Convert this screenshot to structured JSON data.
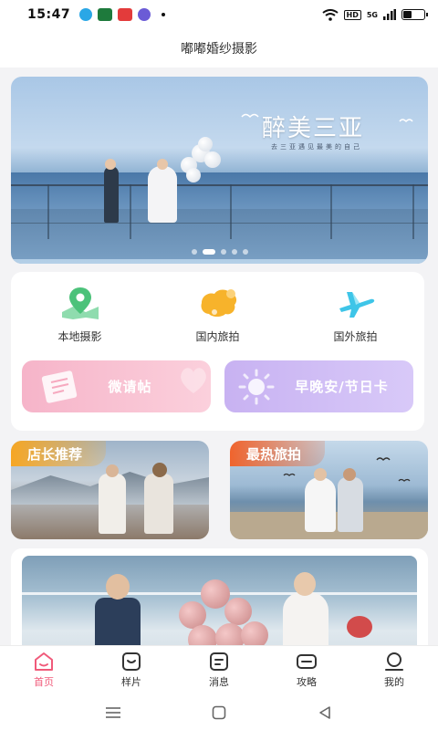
{
  "status_bar": {
    "time": "15:47",
    "network": "HD",
    "signal": "5G",
    "app_icons": [
      "qq-icon",
      "wechat-icon",
      "toutiao-icon",
      "browser-icon"
    ]
  },
  "header": {
    "title": "嘟嘟婚纱摄影"
  },
  "banner": {
    "caption": "醉美三亚",
    "subtitle": "去三亚遇见最美的自己",
    "slide_count": 5,
    "active_slide": 1
  },
  "categories": [
    {
      "label": "本地摄影",
      "icon": "map-pin-icon",
      "color": "#4cc27a"
    },
    {
      "label": "国内旅拍",
      "icon": "china-map-icon",
      "color": "#f7b32b"
    },
    {
      "label": "国外旅拍",
      "icon": "airplane-icon",
      "color": "#3ec5e8"
    }
  ],
  "promos": [
    {
      "label": "微请帖",
      "icon": "invitation-icon"
    },
    {
      "label": "早晚安/节日卡",
      "icon": "sun-icon"
    }
  ],
  "features": [
    {
      "tag": "店长推荐"
    },
    {
      "tag": "最热旅拍"
    }
  ],
  "tabs": [
    {
      "label": "首页",
      "icon": "home-icon",
      "active": true
    },
    {
      "label": "样片",
      "icon": "portfolio-icon",
      "active": false
    },
    {
      "label": "消息",
      "icon": "message-icon",
      "active": false
    },
    {
      "label": "攻略",
      "icon": "guide-icon",
      "active": false
    },
    {
      "label": "我的",
      "icon": "profile-icon",
      "active": false
    }
  ],
  "colors": {
    "accent": "#f05a7a",
    "tag_orange": "#f6a623",
    "tag_red": "#f0642d"
  }
}
